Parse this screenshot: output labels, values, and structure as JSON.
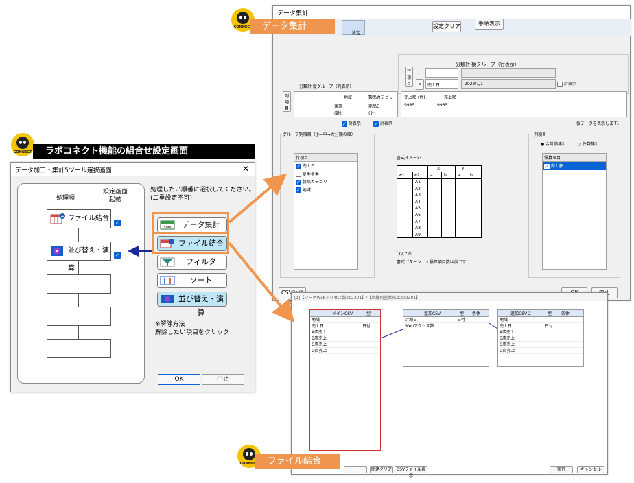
{
  "labels": {
    "data_aggregation": "データ集計",
    "file_merge": "ファイル結合",
    "combo_setting": "ラボコネクト機能の組合せ設定画面",
    "logo_text": "CONNECT"
  },
  "selector": {
    "title": "データ加工・集計5ツール選択画面",
    "col_order": "処理順",
    "col_launch": "設定画面\n起動",
    "instruction": "処理したい順番に選択してください。\n(二重設定不可)",
    "selected": [
      {
        "label": "ファイル結合",
        "checked": true
      },
      {
        "label": "並び替え・演算",
        "checked": true
      }
    ],
    "tools": [
      {
        "label": "データ集計"
      },
      {
        "label": "ファイル結合"
      },
      {
        "label": "フィルタ"
      },
      {
        "label": "ソート"
      },
      {
        "label": "並び替え・演算"
      }
    ],
    "note": "※解除方法\n解除したい項目をクリック",
    "ok": "OK",
    "cancel": "中止"
  },
  "agg": {
    "title": "データ集計",
    "top_tab": "設定",
    "clear_btn": "設定クリア",
    "steps_btn": "手順表示",
    "row_group_title": "分類計 横グループ（行表示）",
    "row_item": "行項目",
    "day_btn": "日",
    "row_field": "売上日",
    "row_value": "2023/1/1",
    "row_total": "計表示",
    "col_group_title": "分類計 縦グループ（列表示）",
    "col_item": "列項目",
    "col_headers": [
      "地域",
      "製品カテゴリ"
    ],
    "col_cells": [
      "東京",
      "商品E",
      "(計)",
      "(計)"
    ],
    "val_headers": [
      "売上額 (件)",
      "売上額"
    ],
    "val_cells": [
      "9985",
      "9985"
    ],
    "total1": "計表示",
    "total2": "計表示",
    "virtual_note": "仮データを表示します。",
    "group_list_title": "グループ列項目（小→中→大分類の順）",
    "row_list_header": "行項目",
    "row_list": [
      {
        "label": "売上日",
        "checked": true
      },
      {
        "label": "夏季冬季",
        "checked": false
      },
      {
        "label": "製品カテゴリ",
        "checked": true
      },
      {
        "label": "地域",
        "checked": true
      }
    ],
    "format_title": "書式イメージ",
    "format_cols": [
      "X",
      "Y"
    ],
    "format_sub": [
      "w1",
      "w2",
      "a",
      "b",
      "a",
      "b"
    ],
    "format_rows": [
      "A1",
      "A2",
      "A3",
      "A4",
      "A5",
      "A6",
      "A7",
      "A8",
      "A9"
    ],
    "format_xy": "（X2,Y2）",
    "format_note": "書式パターン　ｘ積算項目数は仮です",
    "col_item_title": "列項目",
    "radio_sum": "合計値集計",
    "radio_count": "件数集計",
    "acc_header": "積算項目",
    "acc_item": "売上額",
    "csv_btn": "CSVﾌｧｲﾙ表示",
    "ok": "OK",
    "cancel": "中止"
  },
  "merge": {
    "title": "[1]【マーケWebアクセス数202301】/【店舗別営業売上202301】",
    "main_csv": "メインCSV",
    "type": "型",
    "cond": "条件",
    "main_rows": [
      {
        "name": "地域",
        "type": ""
      },
      {
        "name": "売上日",
        "type": "日付"
      },
      {
        "name": "A店売上",
        "type": ""
      },
      {
        "name": "B店売上",
        "type": ""
      },
      {
        "name": "C店売上",
        "type": ""
      },
      {
        "name": "D店売上",
        "type": ""
      }
    ],
    "add_csv": "追加CSV",
    "add_rows": [
      {
        "name": "計測日",
        "type": "日付"
      },
      {
        "name": "Webアクセス数",
        "type": ""
      }
    ],
    "add_csv2": "追加CSV 2",
    "add2_rows": [
      {
        "name": "地域",
        "type": ""
      },
      {
        "name": "売上日",
        "type": "日付"
      },
      {
        "name": "A店売上",
        "type": ""
      },
      {
        "name": "B店売上",
        "type": ""
      },
      {
        "name": "C店売上",
        "type": ""
      },
      {
        "name": "D店売上",
        "type": ""
      }
    ],
    "clear_btn": "関連クリア",
    "csv_btn": "CSVファイル表示",
    "run": "実行",
    "cancel": "キャンセル"
  },
  "colors": {
    "orange": "#f0954d",
    "accent": "#0a64d6",
    "red": "#d03030",
    "arrow": "#1a2a9a"
  }
}
